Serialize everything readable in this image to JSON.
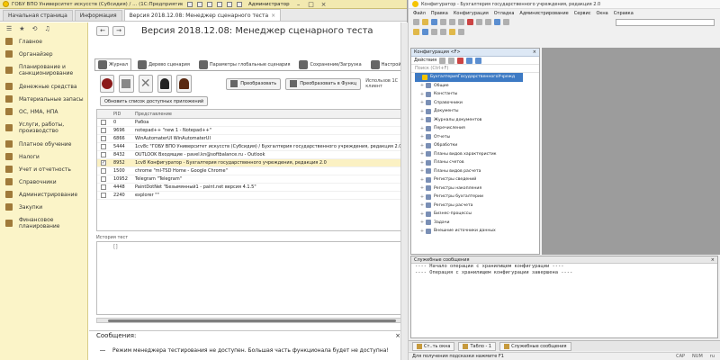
{
  "left_window": {
    "title": "ГОБУ ВПО Университет искусств (Субсидия) / ... (1С:Предприятие)",
    "user": "Администратор",
    "tabs": [
      {
        "label": "Начальная страница"
      },
      {
        "label": "Информация"
      },
      {
        "label": "Версия 2018.12.08: Менеджер сценарного теста"
      }
    ],
    "sidebar": [
      {
        "label": "Главное",
        "icon": "home-icon"
      },
      {
        "label": "Органайзер",
        "icon": "organizer-icon"
      },
      {
        "label": "Планирование и санкционирование",
        "icon": "planning-icon"
      },
      {
        "label": "Денежные средства",
        "icon": "money-icon"
      },
      {
        "label": "Материальные запасы",
        "icon": "stock-icon"
      },
      {
        "label": "ОС, НМА, НПА",
        "icon": "assets-icon"
      },
      {
        "label": "Услуги, работы, производство",
        "icon": "services-icon"
      },
      {
        "label": "Платное обучение",
        "icon": "education-icon"
      },
      {
        "label": "Налоги",
        "icon": "taxes-icon"
      },
      {
        "label": "Учет и отчетность",
        "icon": "reports-icon"
      },
      {
        "label": "Справочники",
        "icon": "catalogs-icon"
      },
      {
        "label": "Администрирование",
        "icon": "admin-icon"
      },
      {
        "label": "Закупки",
        "icon": "purchases-icon"
      },
      {
        "label": "Финансовое планирование",
        "icon": "finplan-icon"
      }
    ],
    "form": {
      "title": "Версия 2018.12.08: Менеджер сценарного теста",
      "tabs": [
        "Журнал",
        "Дерево сценария",
        "Параметры глобальные сценария",
        "Сохранение/Загрузка",
        "Настрой"
      ],
      "btn_convert": "Преобразовать",
      "btn_convert_fn": "Преобразовать в Функц",
      "use_label": "Использов\n1С клиент",
      "refresh_btn": "Обновить список доступных приложений",
      "grid_headers": {
        "pid": "PID",
        "presentation": "Представление"
      },
      "rows": [
        {
          "pid": "0",
          "text": "Рабоа",
          "checked": false
        },
        {
          "pid": "9696",
          "text": "notepad++ \"new 1 - Notepad++\"",
          "checked": false
        },
        {
          "pid": "6866",
          "text": "WinAutomaterUI WinAutomaterUI",
          "checked": false
        },
        {
          "pid": "5444",
          "text": "1cv8c \"ГОБУ ВПО Университет искусств (Субсидия) / Бухгалтерия государственного учреждения, редакция 2.0\"",
          "checked": false
        },
        {
          "pid": "8432",
          "text": "OUTLOOK Входящие - pavel.kn@softbalance.ru - Outlook",
          "checked": false
        },
        {
          "pid": "8952",
          "text": "1cv8 Конфигуратор - Бухгалтерия государственного учреждения, редакция 2.0",
          "checked": true
        },
        {
          "pid": "1500",
          "text": "chrome \"ml-TSD Home - Google Chrome\"",
          "checked": false
        },
        {
          "pid": "10952",
          "text": "Telegram \"Telegram\"",
          "checked": false
        },
        {
          "pid": "4448",
          "text": "PaintDotNet \"Безымянный1 - paint.net версия 4.1.5\"",
          "checked": false
        },
        {
          "pid": "2240",
          "text": "explorer \"\"",
          "checked": false
        }
      ],
      "history_label": "История тест",
      "history_text": "[]"
    },
    "messages": {
      "title": "Сообщения:",
      "close": "×",
      "line": "Режим менеджера тестирования не доступен. Большая часть функционала будет не доступна!"
    }
  },
  "right_window": {
    "title": "Конфигуратор - Бухгалтерия государственного учреждения, редакция 2.0",
    "menu": [
      "Файл",
      "Правка",
      "Конфигурация",
      "Отладка",
      "Администрирование",
      "Сервис",
      "Окна",
      "Справка"
    ],
    "config_panel": {
      "title": "Конфигурация <F>",
      "actions": "Действия",
      "search_placeholder": "Поиск (Ctrl+F)",
      "root": "БухгалтерияГосударственногоУчрежд",
      "items": [
        "Общие",
        "Константы",
        "Справочники",
        "Документы",
        "Журналы документов",
        "Перечисления",
        "Отчеты",
        "Обработки",
        "Планы видов характеристик",
        "Планы счетов",
        "Планы видов расчета",
        "Регистры сведений",
        "Регистры накопления",
        "Регистры бухгалтерии",
        "Регистры расчета",
        "Бизнес-процессы",
        "Задачи",
        "Внешние источники данных"
      ]
    },
    "service_panel": {
      "title": "Служебные сообщения",
      "lines": [
        "---- Начало операции с хранилищем конфигурации ----",
        "---- Операция с хранилищем конфигурации завершена ----"
      ]
    },
    "bottom_tabs": [
      "Ст..ть окна",
      "Табло - 1",
      "Служебные сообщения"
    ],
    "status": {
      "hint": "Для получения подсказки нажмите F1",
      "cap": "CAP",
      "num": "NUM",
      "lang": "ru"
    }
  }
}
